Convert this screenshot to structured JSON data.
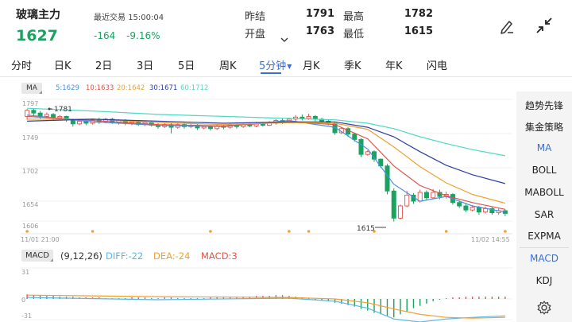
{
  "header": {
    "title": "玻璃主力",
    "price": "1627",
    "last_trade_label": "最近交易",
    "last_trade_time": "15:00:04",
    "change": "-164",
    "change_pct": "-9.16%",
    "stats": [
      {
        "label": "昨结",
        "value": "1791"
      },
      {
        "label": "最高",
        "value": "1782"
      },
      {
        "label": "开盘",
        "value": "1763"
      },
      {
        "label": "最低",
        "value": "1615"
      }
    ],
    "expand_icon": "chevron-down-icon",
    "draw_icon": "pen-icon",
    "collapse_icon": "collapse-arrows-icon"
  },
  "tabs": [
    {
      "label": "分时",
      "active": false
    },
    {
      "label": "日K",
      "active": false
    },
    {
      "label": "2日",
      "active": false
    },
    {
      "label": "3日",
      "active": false
    },
    {
      "label": "5日",
      "active": false
    },
    {
      "label": "周K",
      "active": false
    },
    {
      "label": "5分钟",
      "active": true
    },
    {
      "label": "月K",
      "active": false
    },
    {
      "label": "季K",
      "active": false
    },
    {
      "label": "年K",
      "active": false
    },
    {
      "label": "闪电",
      "active": false
    }
  ],
  "ma_legend": {
    "badge": "MA",
    "items": [
      {
        "text": "5:1629",
        "color": "#4a90e2"
      },
      {
        "text": "10:1633",
        "color": "#e0544a"
      },
      {
        "text": "20:1642",
        "color": "#f0a030"
      },
      {
        "text": "30:1671",
        "color": "#2a3fa0"
      },
      {
        "text": "60:1712",
        "color": "#4fd8c4"
      }
    ]
  },
  "price_axis": {
    "labels": [
      "1797",
      "1749",
      "1702",
      "1654",
      "1606"
    ],
    "high_marker": "1781",
    "low_marker": "1615"
  },
  "time_axis": {
    "start": "11/01 21:00",
    "end": "11/02 14:55"
  },
  "macd_legend": {
    "badge": "MACD",
    "params": "(9,12,26)",
    "diff": "DIFF:-22",
    "dea": "DEA:-24",
    "macd": "MACD:3",
    "diff_color": "#5ab8e8",
    "dea_color": "#f0a030",
    "macd_color": "#e0544a"
  },
  "macd_axis": {
    "top": "31",
    "mid": "0",
    "bottom": "-31"
  },
  "side_panel": [
    {
      "label": "趋势先锋",
      "active": false
    },
    {
      "label": "集金策略",
      "active": false
    },
    {
      "label": "MA",
      "active": true
    },
    {
      "label": "BOLL",
      "active": false
    },
    {
      "label": "MABOLL",
      "active": false
    },
    {
      "label": "SAR",
      "active": false
    },
    {
      "label": "EXPMA",
      "active": false
    },
    {
      "label": "MACD",
      "active": true
    },
    {
      "label": "KDJ",
      "active": false
    }
  ],
  "settings_icon": "gear-icon",
  "colors": {
    "up": "#e0544a",
    "down": "#1aa260",
    "accent": "#3a6fd8"
  },
  "chart_data": {
    "type": "candlestick",
    "y_range": [
      1597,
      1801
    ],
    "candles": [
      [
        1770,
        1779,
        1765,
        1781
      ],
      [
        1779,
        1775,
        1770,
        1782
      ],
      [
        1775,
        1770,
        1766,
        1778
      ],
      [
        1770,
        1773,
        1768,
        1776
      ],
      [
        1773,
        1768,
        1764,
        1775
      ],
      [
        1768,
        1770,
        1765,
        1772
      ],
      [
        1770,
        1765,
        1762,
        1771
      ],
      [
        1765,
        1759,
        1755,
        1767
      ],
      [
        1759,
        1763,
        1757,
        1766
      ],
      [
        1763,
        1760,
        1757,
        1765
      ],
      [
        1760,
        1765,
        1758,
        1767
      ],
      [
        1765,
        1762,
        1759,
        1768
      ],
      [
        1762,
        1766,
        1760,
        1768
      ],
      [
        1766,
        1761,
        1759,
        1768
      ],
      [
        1761,
        1764,
        1758,
        1766
      ],
      [
        1764,
        1760,
        1757,
        1766
      ],
      [
        1760,
        1762,
        1757,
        1764
      ],
      [
        1762,
        1758,
        1756,
        1764
      ],
      [
        1758,
        1761,
        1756,
        1763
      ],
      [
        1761,
        1757,
        1755,
        1763
      ],
      [
        1757,
        1755,
        1752,
        1760
      ],
      [
        1755,
        1758,
        1753,
        1760
      ],
      [
        1758,
        1754,
        1745,
        1760
      ],
      [
        1754,
        1758,
        1752,
        1760
      ],
      [
        1758,
        1755,
        1752,
        1761
      ],
      [
        1755,
        1757,
        1753,
        1759
      ],
      [
        1757,
        1753,
        1750,
        1759
      ],
      [
        1753,
        1755,
        1751,
        1757
      ],
      [
        1755,
        1752,
        1749,
        1757
      ],
      [
        1752,
        1756,
        1750,
        1758
      ],
      [
        1756,
        1754,
        1751,
        1758
      ],
      [
        1754,
        1757,
        1752,
        1760
      ],
      [
        1757,
        1755,
        1752,
        1759
      ],
      [
        1755,
        1758,
        1753,
        1760
      ],
      [
        1758,
        1756,
        1754,
        1761
      ],
      [
        1756,
        1759,
        1754,
        1762
      ],
      [
        1759,
        1757,
        1755,
        1762
      ],
      [
        1757,
        1760,
        1756,
        1763
      ],
      [
        1760,
        1764,
        1758,
        1766
      ],
      [
        1764,
        1762,
        1759,
        1767
      ],
      [
        1762,
        1766,
        1760,
        1768
      ],
      [
        1766,
        1769,
        1763,
        1772
      ],
      [
        1769,
        1767,
        1764,
        1773
      ],
      [
        1767,
        1770,
        1765,
        1774
      ],
      [
        1770,
        1766,
        1763,
        1772
      ],
      [
        1766,
        1763,
        1760,
        1768
      ],
      [
        1763,
        1760,
        1757,
        1765
      ],
      [
        1760,
        1746,
        1743,
        1762
      ],
      [
        1746,
        1752,
        1744,
        1754
      ],
      [
        1752,
        1744,
        1740,
        1754
      ],
      [
        1744,
        1736,
        1733,
        1746
      ],
      [
        1736,
        1714,
        1710,
        1738
      ],
      [
        1714,
        1718,
        1712,
        1720
      ],
      [
        1718,
        1707,
        1703,
        1720
      ],
      [
        1707,
        1697,
        1694,
        1708
      ],
      [
        1697,
        1660,
        1655,
        1700
      ],
      [
        1660,
        1620,
        1615,
        1664
      ],
      [
        1620,
        1638,
        1618,
        1640
      ],
      [
        1638,
        1654,
        1636,
        1660
      ],
      [
        1654,
        1645,
        1641,
        1657
      ],
      [
        1645,
        1658,
        1643,
        1662
      ],
      [
        1658,
        1650,
        1646,
        1661
      ],
      [
        1650,
        1658,
        1648,
        1663
      ],
      [
        1658,
        1652,
        1648,
        1662
      ],
      [
        1652,
        1655,
        1649,
        1659
      ],
      [
        1655,
        1643,
        1640,
        1657
      ],
      [
        1643,
        1638,
        1635,
        1646
      ],
      [
        1638,
        1632,
        1629,
        1641
      ],
      [
        1632,
        1636,
        1630,
        1639
      ],
      [
        1636,
        1629,
        1625,
        1638
      ],
      [
        1629,
        1634,
        1627,
        1637
      ],
      [
        1634,
        1628,
        1625,
        1637
      ],
      [
        1628,
        1631,
        1625,
        1634
      ],
      [
        1631,
        1627,
        1623,
        1633
      ]
    ],
    "ma": {
      "MA5": [
        [
          0,
          1772
        ],
        [
          10,
          1762
        ],
        [
          20,
          1757
        ],
        [
          30,
          1755
        ],
        [
          40,
          1764
        ],
        [
          47,
          1754
        ],
        [
          52,
          1722
        ],
        [
          56,
          1670
        ],
        [
          60,
          1645
        ],
        [
          64,
          1652
        ],
        [
          68,
          1638
        ],
        [
          73,
          1629
        ]
      ],
      "MA10": [
        [
          0,
          1770
        ],
        [
          10,
          1764
        ],
        [
          20,
          1758
        ],
        [
          30,
          1756
        ],
        [
          40,
          1762
        ],
        [
          47,
          1758
        ],
        [
          52,
          1737
        ],
        [
          56,
          1697
        ],
        [
          60,
          1668
        ],
        [
          64,
          1653
        ],
        [
          68,
          1643
        ],
        [
          73,
          1633
        ]
      ],
      "MA20": [
        [
          0,
          1766
        ],
        [
          10,
          1766
        ],
        [
          20,
          1761
        ],
        [
          30,
          1758
        ],
        [
          40,
          1761
        ],
        [
          47,
          1760
        ],
        [
          52,
          1751
        ],
        [
          56,
          1725
        ],
        [
          60,
          1696
        ],
        [
          64,
          1672
        ],
        [
          68,
          1655
        ],
        [
          73,
          1642
        ]
      ],
      "MA30": [
        [
          0,
          1763
        ],
        [
          10,
          1766
        ],
        [
          20,
          1763
        ],
        [
          30,
          1760
        ],
        [
          40,
          1762
        ],
        [
          47,
          1762
        ],
        [
          52,
          1754
        ],
        [
          56,
          1740
        ],
        [
          60,
          1718
        ],
        [
          64,
          1698
        ],
        [
          68,
          1684
        ],
        [
          73,
          1671
        ]
      ],
      "MA60": [
        [
          0,
          1782
        ],
        [
          10,
          1778
        ],
        [
          20,
          1773
        ],
        [
          30,
          1770
        ],
        [
          40,
          1767
        ],
        [
          47,
          1765
        ],
        [
          52,
          1760
        ],
        [
          56,
          1752
        ],
        [
          60,
          1740
        ],
        [
          64,
          1730
        ],
        [
          68,
          1721
        ],
        [
          73,
          1712
        ]
      ]
    },
    "macd": {
      "range": [
        -31,
        31
      ],
      "hist": [
        6,
        5,
        5,
        4,
        4,
        3,
        3,
        3,
        2,
        2,
        2,
        2,
        1,
        1,
        1,
        1,
        2,
        2,
        2,
        1,
        1,
        2,
        2,
        1,
        1,
        1,
        1,
        1,
        2,
        2,
        2,
        2,
        2,
        3,
        3,
        4,
        4,
        4,
        5,
        5,
        4,
        3,
        2,
        1,
        -1,
        -2,
        -3,
        -5,
        -6,
        -8,
        -10,
        -13,
        -15,
        -18,
        -20,
        -22,
        -24,
        -20,
        -16,
        -12,
        -9,
        -6,
        -3,
        -1,
        1,
        2,
        2,
        3,
        3,
        3,
        3,
        3,
        3,
        3
      ],
      "diff": [
        [
          0,
          2
        ],
        [
          20,
          -1
        ],
        [
          40,
          1
        ],
        [
          47,
          -3
        ],
        [
          52,
          -12
        ],
        [
          56,
          -26
        ],
        [
          60,
          -30
        ],
        [
          64,
          -26
        ],
        [
          68,
          -24
        ],
        [
          73,
          -22
        ]
      ],
      "dea": [
        [
          0,
          5
        ],
        [
          20,
          3
        ],
        [
          40,
          2
        ],
        [
          47,
          0
        ],
        [
          52,
          -5
        ],
        [
          56,
          -13
        ],
        [
          60,
          -20
        ],
        [
          64,
          -24
        ],
        [
          68,
          -25
        ],
        [
          73,
          -24
        ]
      ]
    },
    "event_dots": [
      0,
      10,
      28,
      40,
      43,
      53,
      64,
      73
    ]
  }
}
